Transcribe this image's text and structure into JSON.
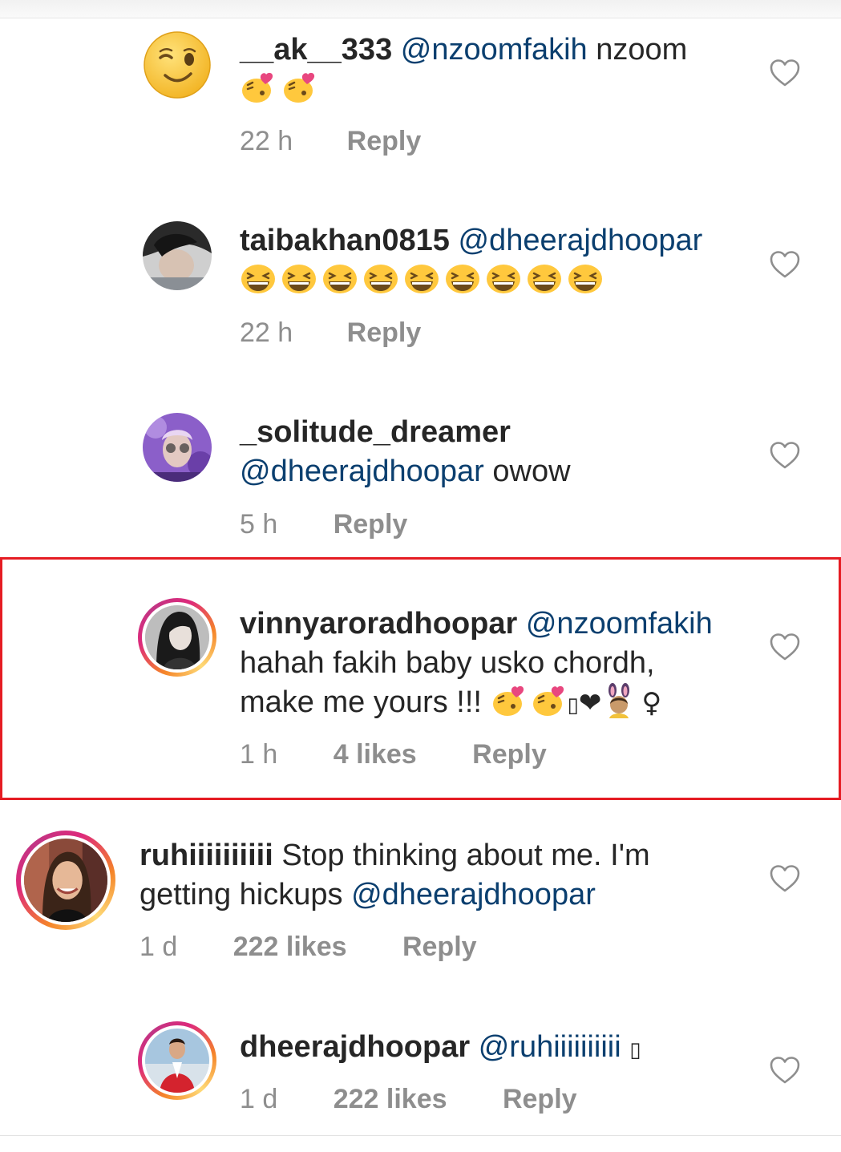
{
  "comments": [
    {
      "username": "__ak__333",
      "mention": "@nzoomfakih",
      "text": "nzoom",
      "emojis": [
        "kissing-heart-emoji",
        "kissing-heart-emoji"
      ],
      "time": "22 h",
      "likes": "",
      "reply": "Reply"
    },
    {
      "username": "taibakhan0815",
      "mention": "@dheerajdhoopar",
      "text": "",
      "emojis": [
        "grinning-squint-emoji",
        "grinning-squint-emoji",
        "grinning-squint-emoji",
        "grinning-squint-emoji",
        "grinning-squint-emoji",
        "grinning-squint-emoji",
        "grinning-squint-emoji",
        "grinning-squint-emoji",
        "grinning-squint-emoji"
      ],
      "time": "22 h",
      "likes": "",
      "reply": "Reply"
    },
    {
      "username": "_solitude_dreamer",
      "mention": "@dheerajdhoopar",
      "text": "owow",
      "time": "5 h",
      "likes": "",
      "reply": "Reply"
    },
    {
      "username": "vinnyarorādhoopar",
      "username_display": "vinnyaroradhoopar",
      "mention": "@nzoomfakih",
      "text_line1": "hahah fakih baby usko chordh,",
      "text_line2": "make me yours !!!",
      "trailing_glyphs": "❤",
      "tail_symbol": "♀",
      "missing_glyph": "▯",
      "time": "1 h",
      "likes": "4 likes",
      "reply": "Reply",
      "highlighted": true
    },
    {
      "username": "ruhiiiiiiiiii",
      "text_line1": "Stop thinking about me. I'm",
      "text_line2": "getting hickups",
      "mention": "@dheerajdhoopar",
      "time": "1 d",
      "likes": "222 likes",
      "reply": "Reply"
    },
    {
      "username": "dheerajdhoopar",
      "mention": "@ruhiiiiiiiiii",
      "missing_glyph": "▯",
      "time": "1 d",
      "likes": "222 likes",
      "reply": "Reply"
    }
  ],
  "colors": {
    "text": "#262626",
    "mention": "#0b3f6f",
    "meta": "#8e8e8e",
    "highlight_border": "#e51c23",
    "emoji_yellow": "#ffc83d"
  }
}
